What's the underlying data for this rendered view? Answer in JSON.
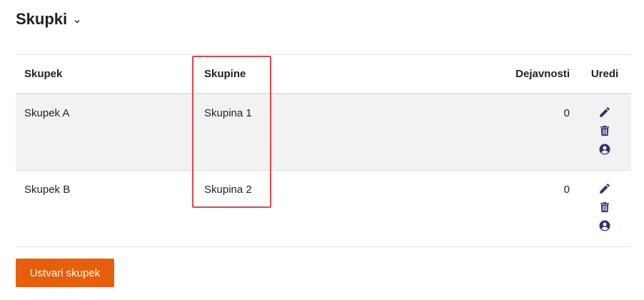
{
  "header": {
    "title": "Skupki"
  },
  "table": {
    "columns": [
      "Skupek",
      "Skupine",
      "Dejavnosti",
      "Uredi"
    ],
    "rows": [
      {
        "skupek": "Skupek A",
        "skupine": "Skupina 1",
        "dejavnosti": "0"
      },
      {
        "skupek": "Skupek B",
        "skupine": "Skupina 2",
        "dejavnosti": "0"
      }
    ]
  },
  "actions": {
    "create_label": "Ustvari skupek"
  },
  "icons": {
    "edit": "pencil-icon",
    "delete": "trash-icon",
    "assign": "user-circle-icon"
  },
  "colors": {
    "accent": "#3c2a78",
    "primary_button": "#e75f0c",
    "highlight": "#e0474c",
    "row_stripe": "#f2f2f2"
  }
}
